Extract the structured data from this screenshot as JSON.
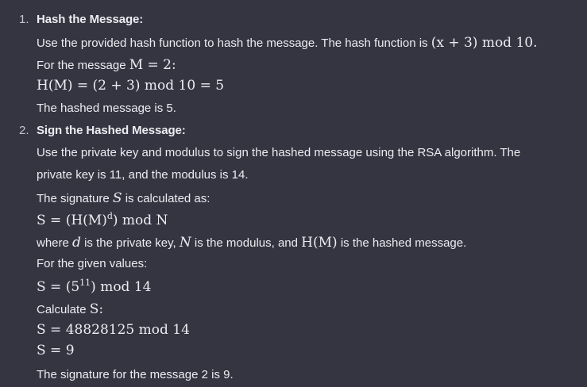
{
  "steps": [
    {
      "number": "1.",
      "title": "Hash the Message:",
      "lines": {
        "l1_text": "Use the provided hash function to hash the message. The hash function is ",
        "l1_math": "(x + 3)  mod 10.",
        "l2_text": "For the message ",
        "l2_math": "M = 2:",
        "l3_math": "H(M) = (2 + 3)  mod 10 = 5",
        "l4_text": "The hashed message is 5."
      }
    },
    {
      "number": "2.",
      "title": "Sign the Hashed Message:",
      "lines": {
        "l1_text": "Use the private key and modulus to sign the hashed message using the RSA algorithm. The",
        "l2_text": "private key is 11, and the modulus is 14.",
        "l3_text_a": "The signature ",
        "l3_math": "S",
        "l3_text_b": " is calculated as:",
        "l4_math": "S = (H(M)",
        "l4_sup": "d",
        "l4_math_b": ")  mod N",
        "l5_text_a": "where ",
        "l5_math_a": "d",
        "l5_text_b": " is the private key, ",
        "l5_math_b": "N",
        "l5_text_c": " is the modulus, and ",
        "l5_math_c": "H(M)",
        "l5_text_d": " is the hashed message.",
        "l6_text": "For the given values:",
        "l7_math": "S = (5",
        "l7_sup": "11",
        "l7_math_b": ")  mod 14",
        "l8_text": "Calculate ",
        "l8_math": "S:",
        "l9_math": "S = 48828125  mod 14",
        "l10_math": "S = 9",
        "l11_text": "The signature for the message 2 is 9."
      }
    }
  ]
}
